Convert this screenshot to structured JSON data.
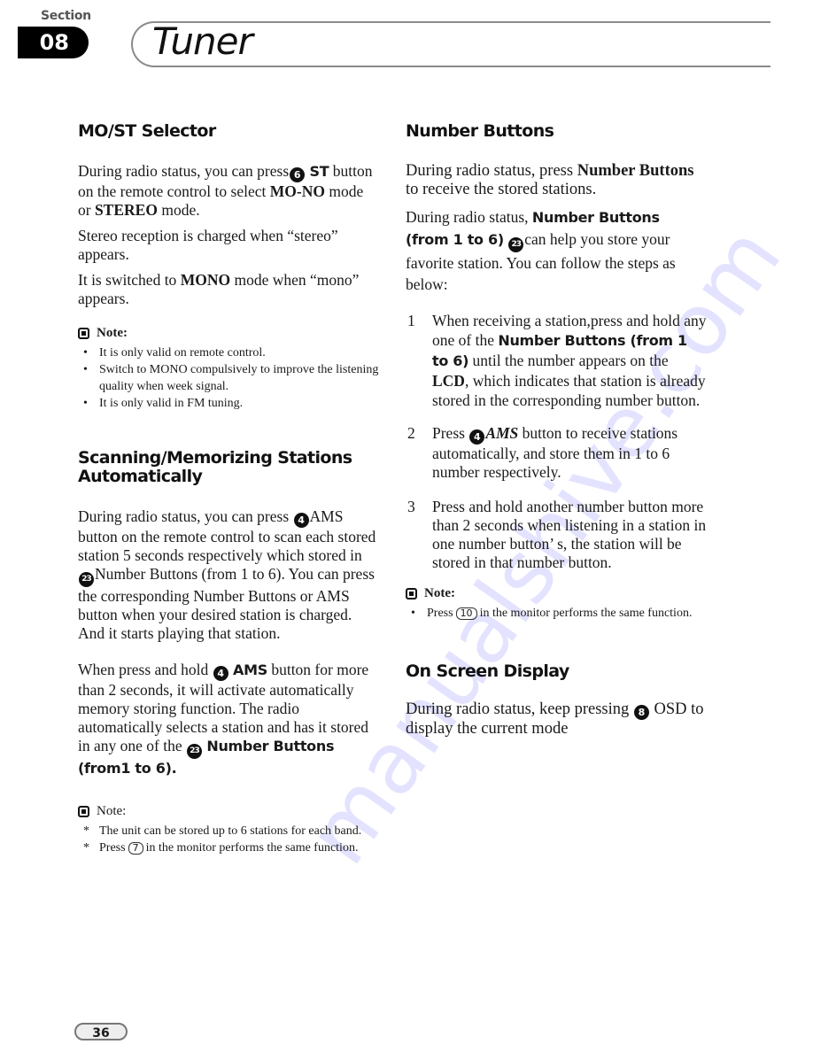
{
  "header": {
    "section_label": "Section",
    "section_number": "08",
    "title": "Tuner"
  },
  "left": {
    "mo_st": {
      "heading": "MO/ST Selector",
      "p1": {
        "pre": "During radio status, you can press",
        "icon": "6",
        "bold1": "ST",
        "mid": "button on the remote control to select",
        "bold2": "MO-NO",
        "mid2": "mode or",
        "bold3": "STEREO",
        "post": "mode."
      },
      "p2": "Stereo reception is charged when “stereo” appears.",
      "p3": {
        "pre": "It is switched to",
        "bold": "MONO",
        "post": "mode when “mono” appears."
      },
      "note_label": "Note:",
      "notes": [
        "It is only valid on remote control.",
        "Switch to MONO compulsively to improve the listening quality when week signal.",
        "It is only valid in FM tuning."
      ]
    },
    "scan": {
      "heading": "Scanning/Memorizing Stations Automatically",
      "p1": {
        "pre": "During radio status, you can press",
        "icon1": "4",
        "mid1": "AMS button on the remote control to scan each stored station 5 seconds respectively which stored in",
        "icon2": "23",
        "post": "Number Buttons (from 1 to 6). You can press the corresponding Number Buttons or AMS button when your desired station is charged. And it starts playing that station."
      },
      "p2": {
        "pre": "When press and hold",
        "icon1": "4",
        "bold1": "AMS",
        "mid": "button for more than 2 seconds, it will activate automatically memory storing function. The radio automatically selects a station and has it stored in any one of the",
        "icon2": "23",
        "bold2": "Number Buttons (from1 to 6)."
      },
      "note_label": "Note:",
      "notes": [
        {
          "text": "The unit can be stored up to 6 stations for each band."
        },
        {
          "pre": "Press",
          "key": "7",
          "post": "in the monitor performs the same function."
        }
      ]
    }
  },
  "right": {
    "number_buttons": {
      "heading": "Number Buttons",
      "p1": {
        "pre": "During radio status, press",
        "bold": "Number Buttons",
        "post": "to receive the stored stations."
      },
      "p2": {
        "pre": "During radio status,",
        "bold": "Number Buttons (from 1 to 6)",
        "icon": "23",
        "post": "can help you store your favorite station. You can follow the steps as below:"
      },
      "steps": [
        {
          "num": "1",
          "pre": "When receiving a station,press and hold any one of the",
          "bold": "Number Buttons (from 1 to 6)",
          "mid": "until the number appears on the",
          "bold2": "LCD",
          "post": ", which indicates that station is already stored in the corresponding number button."
        },
        {
          "num": "2",
          "pre": "Press",
          "icon": "4",
          "italic": "AMS",
          "post": "button to receive stations automatically, and store them in 1 to 6 number respectively."
        },
        {
          "num": "3",
          "text": "Press and hold another number button more than 2 seconds when listening in a station in one number button’ s, the station will be stored in that number button."
        }
      ],
      "note_label": "Note:",
      "notes": [
        {
          "pre": "Press",
          "key": "10",
          "post": "in the monitor performs the same function."
        }
      ]
    },
    "osd": {
      "heading": "On Screen Display",
      "p1": {
        "pre": "During radio status, keep pressing",
        "icon": "8",
        "post": "OSD to display the current mode"
      }
    }
  },
  "footer": {
    "page_number": "36"
  },
  "watermark": "manualshive.com"
}
